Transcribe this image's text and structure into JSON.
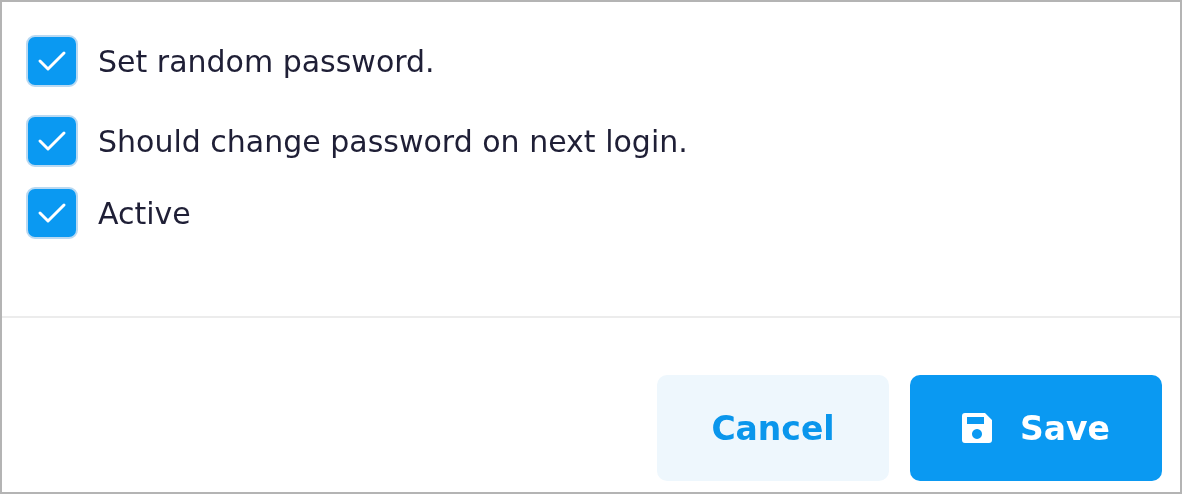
{
  "options": [
    {
      "label": "Set random password.",
      "checked": true
    },
    {
      "label": "Should change password on next login.",
      "checked": true
    },
    {
      "label": "Active",
      "checked": true
    }
  ],
  "buttons": [
    {
      "label": "Cancel",
      "kind": "secondary"
    },
    {
      "label": "Save",
      "kind": "primary"
    }
  ]
}
